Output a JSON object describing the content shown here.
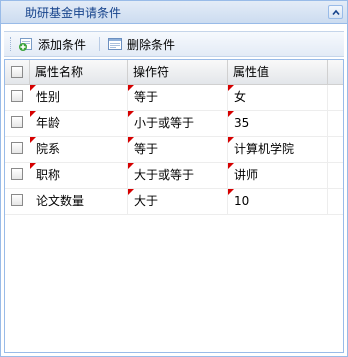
{
  "panel": {
    "title": "助研基金申请条件",
    "collapse_icon": "chevron-up-icon"
  },
  "toolbar": {
    "add_label": "添加条件",
    "add_icon": "add-icon",
    "delete_label": "删除条件",
    "delete_icon": "delete-icon"
  },
  "grid": {
    "columns": [
      "属性名称",
      "操作符",
      "属性值"
    ],
    "rows": [
      {
        "name": "性别",
        "operator": "等于",
        "value": "女"
      },
      {
        "name": "年龄",
        "operator": "小于或等于",
        "value": "35"
      },
      {
        "name": "院系",
        "operator": "等于",
        "value": "计算机学院"
      },
      {
        "name": "职称",
        "operator": "大于或等于",
        "value": "讲师"
      },
      {
        "name": "论文数量",
        "operator": "大于",
        "value": "10"
      }
    ]
  },
  "colors": {
    "header_text": "#15428b",
    "border": "#99bbe8",
    "dirty_marker": "#d60000"
  }
}
